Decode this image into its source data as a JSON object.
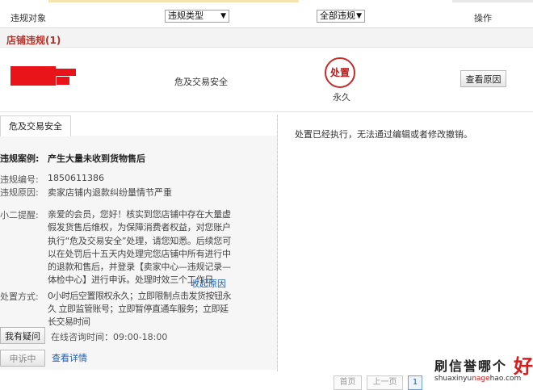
{
  "header": {
    "col_target": "违规对象",
    "type_filter": "违规类型",
    "status_filter": "全部违规",
    "col_action": "操作"
  },
  "section": {
    "title": "店铺违规(1)"
  },
  "violation": {
    "type": "危及交易安全",
    "penalty_stamp": "处置",
    "duration": "永久",
    "view_reason_button": "查看原因"
  },
  "detail": {
    "tab_label": "危及交易安全",
    "case_key": "违规案例:",
    "case_value": "产生大量未收到货物售后",
    "number_key": "违规编号:",
    "number_value": "1850611386",
    "reason_key": "违规原因:",
    "reason_value": "卖家店铺内退款纠纷量情节严重",
    "reminder_key": "小二提醒:",
    "reminder_value": "亲爱的会员，您好！核实到您店铺中存在大量虚假发货售后维权，为保障消费者权益，对您账户执行“危及交易安全”处理，请您知悉。后续您可以在处罚后十五天内处理完您店铺中所有进行中的退款和售后，并登录【卖家中心—违规记录—体检中心】进行申诉。处理时效三个工作日",
    "collapse_link": "收起原因",
    "action_key": "处置方式:",
    "action_value": "0小时后空置限权永久；立即限制点击发货按钮永久 立即监管账号；立即暂停直通车服务；立即延长交易时间",
    "question_button": "我有疑问",
    "consult_time": "在线咨询时间：09:00-18:00",
    "appeal_button": "申诉中",
    "view_detail_link": "查看详情",
    "right_note": "处置已经执行，无法通过编辑或者修改撤销。"
  },
  "pager": {
    "first": "首页",
    "prev": "上一页",
    "current": "1"
  },
  "watermark": {
    "main": "刷信誉哪个",
    "big": "好",
    "url_a": "shuaxinyu",
    "url_b": "nage",
    "url_c": "hao.com"
  },
  "colors": {
    "title_red": "#b0332b",
    "stamp_red": "#c72a2a",
    "link_blue": "#1f5fae",
    "redact": "#e8141a"
  }
}
